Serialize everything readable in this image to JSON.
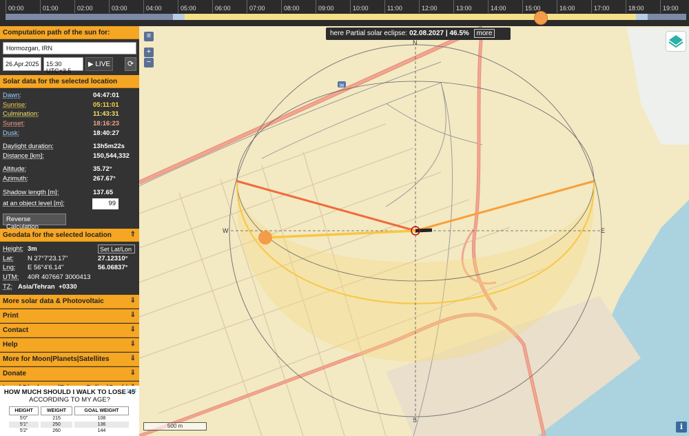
{
  "timeline": {
    "hours": [
      "00:00",
      "01:00",
      "02:00",
      "03:00",
      "04:00",
      "05:00",
      "06:00",
      "07:00",
      "08:00",
      "09:00",
      "10:00",
      "11:00",
      "12:00",
      "13:00",
      "14:00",
      "15:00",
      "16:00",
      "17:00",
      "18:00",
      "19:00"
    ]
  },
  "location": {
    "value": "Hormozgan, IRN"
  },
  "date_value": "26.Apr.2025",
  "time_value": "15:30 UTC+3.5",
  "live_label": "LIVE",
  "sections": {
    "computation_path": "Computation path of the sun for:",
    "solar_data": "Solar data for the selected location",
    "geodata": "Geodata for the selected location"
  },
  "solar": {
    "dawn": {
      "label": "Dawn:",
      "value": "04:47:01"
    },
    "sunrise": {
      "label": "Sunrise:",
      "value": "05:11:01"
    },
    "culmination": {
      "label": "Culmination:",
      "value": "11:43:31"
    },
    "sunset": {
      "label": "Sunset:",
      "value": "18:16:23"
    },
    "dusk": {
      "label": "Dusk:",
      "value": "18:40:27"
    },
    "daylight": {
      "label": "Daylight duration:",
      "value": "13h5m22s"
    },
    "distance": {
      "label": "Distance [km]:",
      "value": "150,544,332"
    },
    "altitude": {
      "label": "Altitude:",
      "value": "35.72°"
    },
    "azimuth": {
      "label": "Azimuth:",
      "value": "267.67°"
    },
    "shadow": {
      "label": "Shadow length [m]:",
      "value": "137.65"
    },
    "object_level": {
      "label": "at an object level [m]:",
      "value": "99"
    }
  },
  "reverse_button": "Reverse Calculation",
  "geodata": {
    "height": {
      "label": "Height:",
      "value": "3m"
    },
    "set_latlon": "Set Lat/Lon",
    "lat": {
      "label": "Lat:",
      "dms": "N 27°7'23.17''",
      "dec": "27.12310°"
    },
    "lng": {
      "label": "Lng:",
      "dms": "E 56°4'6.14''",
      "dec": "56.06837°"
    },
    "utm": {
      "label": "UTM:",
      "value": "40R 407667 3000413"
    },
    "tz": {
      "label": "TZ:",
      "value": "Asia/Tehran",
      "offset": "+0330"
    }
  },
  "menu": [
    "More solar data & Photovoltaic",
    "Print",
    "Contact",
    "Help",
    "More for Moon|Planets|Satellites",
    "Donate",
    "Legal Disclosure|Privacy Policy|Cookies"
  ],
  "ad": {
    "line1": "HOW MUCH SHOULD I WALK TO LOSE 45",
    "line2": "ACCORDING TO MY AGE?",
    "headers": [
      "HEIGHT",
      "WEIGHT",
      "GOAL WEIGHT"
    ],
    "rows": [
      [
        "5'0\"",
        "215",
        "108"
      ],
      [
        "5'1\"",
        "250",
        "136"
      ],
      [
        "5'2\"",
        "260",
        "144"
      ]
    ]
  },
  "eclipse": {
    "prefix": "here Partial solar eclipse:",
    "value": "02.08.2027 | 46.5%",
    "more": "more"
  },
  "map": {
    "north": "N",
    "south": "S",
    "west": "W",
    "east": "E",
    "scale": "500 m",
    "road_label": "96"
  },
  "colors": {
    "accent": "#f5a623",
    "sun": "#f39c4a",
    "sunrise_line": "#f7c744",
    "sunset_line": "#f06a3a"
  }
}
